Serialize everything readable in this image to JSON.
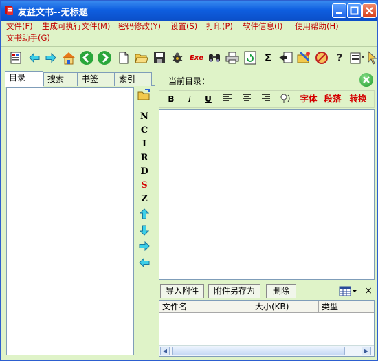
{
  "window": {
    "title": "友益文书--无标题"
  },
  "menu": [
    "文件(F)",
    "生成可执行文件(M)",
    "密码修改(Y)",
    "设置(S)",
    "打印(P)",
    "软件信息(I)",
    "使用帮助(H)",
    "文书助手(G)"
  ],
  "toolbar": {
    "icons": [
      "catalog-icon",
      "back-arrow-icon",
      "forward-arrow-icon",
      "home-icon",
      "green-back-icon",
      "green-forward-icon",
      "new-document-icon",
      "open-folder-icon",
      "save-icon",
      "bug-icon",
      "exe-icon",
      "binoculars-icon",
      "printer-icon",
      "refresh-icon",
      "sigma-icon",
      "import-icon",
      "tools-icon",
      "stop-icon",
      "help-icon",
      "properties-icon",
      "pointer-icon"
    ],
    "exe_label": "Exe",
    "sigma_label": "Σ",
    "help_label": "?"
  },
  "left": {
    "tabs": [
      "目录",
      "搜索",
      "书签",
      "索引"
    ],
    "side_tools": [
      "N",
      "C",
      "I",
      "R",
      "D",
      "S",
      "Z"
    ]
  },
  "right": {
    "current_dir_label": "当前目录：",
    "format": {
      "bold": "B",
      "italic": "I",
      "underline": "U",
      "font": "字体",
      "paragraph": "段落",
      "convert": "转换"
    },
    "attachments": {
      "import": "导入附件",
      "save_as": "附件另存为",
      "delete": "删除",
      "close": "×",
      "columns": [
        "文件名",
        "大小(KB)",
        "类型"
      ]
    }
  },
  "colors": {
    "title_blue": "#0f5fe0",
    "panel_green": "#dff3c8",
    "menu_red": "#c00000"
  }
}
